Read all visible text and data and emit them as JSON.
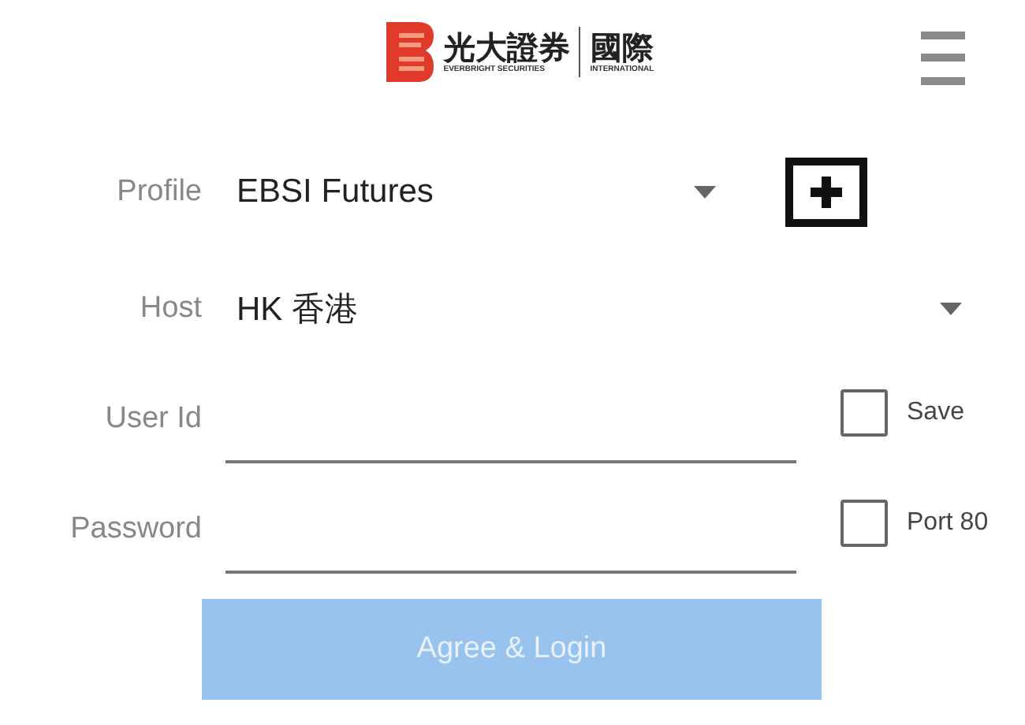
{
  "logo": {
    "name_zh": "光大證券",
    "name_en": "EVERBRIGHT SECURITIES",
    "division_zh": "國際",
    "division_en": "INTERNATIONAL"
  },
  "profile": {
    "label": "Profile",
    "value": "EBSI Futures"
  },
  "host": {
    "label": "Host",
    "value": "HK 香港"
  },
  "fields": [
    {
      "label": "User Id",
      "option": {
        "label": "Save",
        "checked": false
      }
    },
    {
      "label": "Password",
      "option": {
        "label": "Port 80",
        "checked": false
      }
    }
  ],
  "login_button": {
    "label": "Agree & Login",
    "disabled": true
  }
}
